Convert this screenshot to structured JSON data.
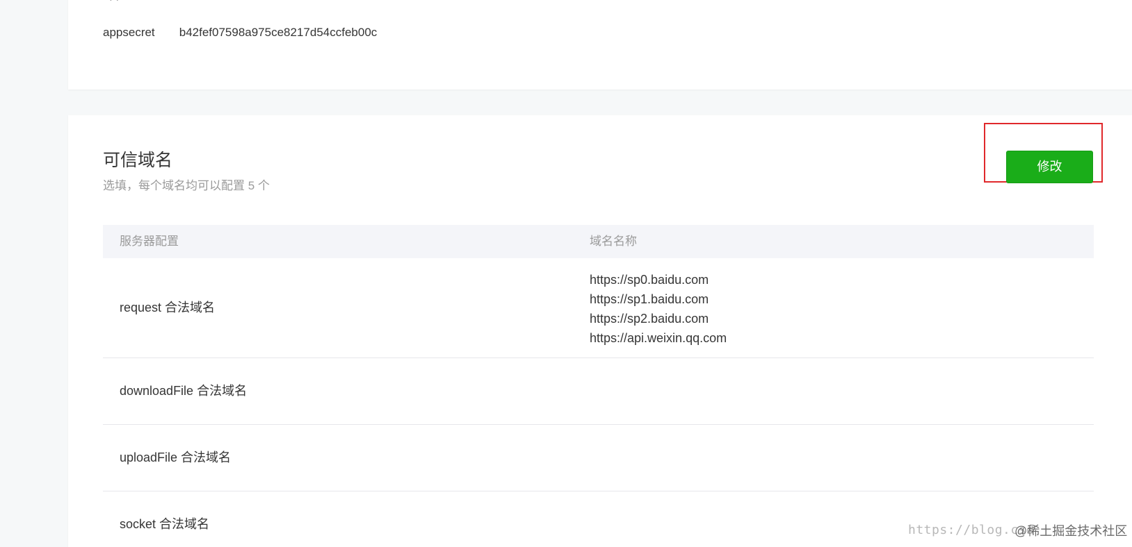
{
  "top_card": {
    "cut_off_label": "app",
    "appsecret_label": "appsecret",
    "appsecret_value": "b42fef07598a975ce8217d54ccfeb00c"
  },
  "domain_section": {
    "title": "可信域名",
    "subtitle": "选填，每个域名均可以配置 5 个",
    "modify_button": "修改",
    "table": {
      "headers": [
        "服务器配置",
        "域名名称"
      ],
      "rows": [
        {
          "label": "request 合法域名",
          "domains": [
            "https://sp0.baidu.com",
            "https://sp1.baidu.com",
            "https://sp2.baidu.com",
            "https://api.weixin.qq.com"
          ]
        },
        {
          "label": "downloadFile 合法域名",
          "domains": []
        },
        {
          "label": "uploadFile 合法域名",
          "domains": []
        },
        {
          "label": "socket 合法域名",
          "domains": []
        }
      ]
    }
  },
  "watermark": {
    "url_text": "https://blog.csd",
    "credit_text": "@稀土掘金技术社区"
  },
  "colors": {
    "page_background": "#f6f8f9",
    "card_background": "#ffffff",
    "primary_button": "#1aad19",
    "highlight_border": "#e0282b",
    "muted_text": "#9a9a9a"
  }
}
